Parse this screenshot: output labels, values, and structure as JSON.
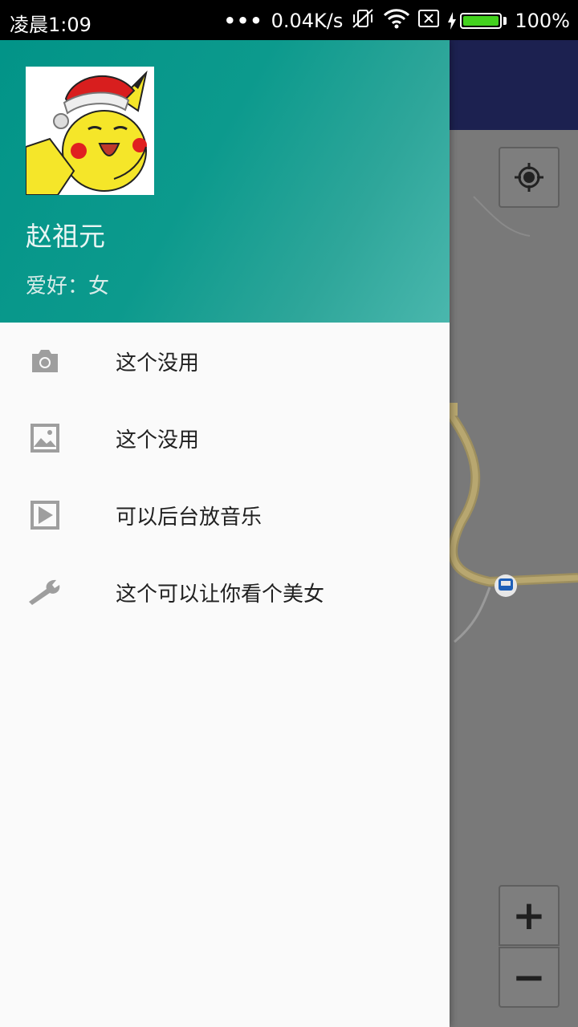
{
  "status_bar": {
    "time": "凌晨1:09",
    "dots": "•••",
    "network_speed": "0.04K/s",
    "battery_percent": "100%",
    "battery_level": 1.0,
    "icons": [
      "vibrate-off-icon",
      "wifi-icon",
      "sim-icon",
      "charging-icon",
      "battery-icon"
    ]
  },
  "drawer": {
    "header": {
      "name": "赵祖元",
      "hobby": "爱好：女"
    },
    "menu": [
      {
        "icon": "camera-icon",
        "label": "这个没用"
      },
      {
        "icon": "image-icon",
        "label": "这个没用"
      },
      {
        "icon": "play-icon",
        "label": "可以后台放音乐"
      },
      {
        "icon": "wrench-icon",
        "label": "这个可以让你看个美女"
      }
    ]
  },
  "map": {
    "zoom_in": "+",
    "zoom_out": "−",
    "colors": {
      "topbar": "#1c2150",
      "road": "#b8a770",
      "bus_stop": "#1d5fb8"
    }
  },
  "colors": {
    "header_start": "#029488",
    "header_end": "#4ab7ad",
    "drawer_bg": "#fafafa",
    "icon_gray": "#9e9e9e"
  }
}
